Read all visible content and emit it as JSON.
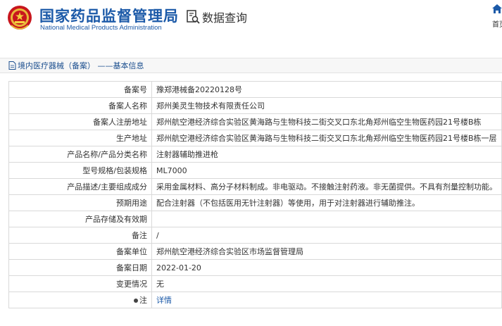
{
  "header": {
    "site_title": "国家药品监督管理局",
    "site_subtitle": "National Medical Products Administration",
    "query_label": "数据查询",
    "home_label": "首页"
  },
  "breadcrumb": {
    "text": "境内医疗器械（备案） ——基本信息"
  },
  "details": {
    "rows": [
      {
        "label": "备案号",
        "value": "豫郑港械备20220128号"
      },
      {
        "label": "备案人名称",
        "value": "郑州美灵生物技术有限责任公司"
      },
      {
        "label": "备案人注册地址",
        "value": "郑州航空港经济综合实验区黄海路与生物科技二街交叉口东北角郑州临空生物医药园21号楼B栋"
      },
      {
        "label": "生产地址",
        "value": "郑州航空港经济综合实验区黄海路与生物科技二街交叉口东北角郑州临空生物医药园21号楼B栋一层"
      },
      {
        "label": "产品名称/产品分类名称",
        "value": "注射器辅助推进枪"
      },
      {
        "label": "型号规格/包装规格",
        "value": "ML7000"
      },
      {
        "label": "产品描述/主要组成成分",
        "value": "采用金属材料、高分子材料制成。非电驱动。不接触注射药液。非无菌提供。不具有剂量控制功能。"
      },
      {
        "label": "预期用途",
        "value": "配合注射器（不包括医用无针注射器）等使用，用于对注射器进行辅助推注。"
      },
      {
        "label": "产品存储及有效期",
        "value": ""
      },
      {
        "label": "备注",
        "value": "/"
      },
      {
        "label": "备案单位",
        "value": "郑州航空港经济综合实验区市场监督管理局"
      },
      {
        "label": "备案日期",
        "value": "2022-01-20"
      },
      {
        "label": "变更情况",
        "value": "无"
      }
    ],
    "note_label": "注",
    "note_link": "详情"
  }
}
